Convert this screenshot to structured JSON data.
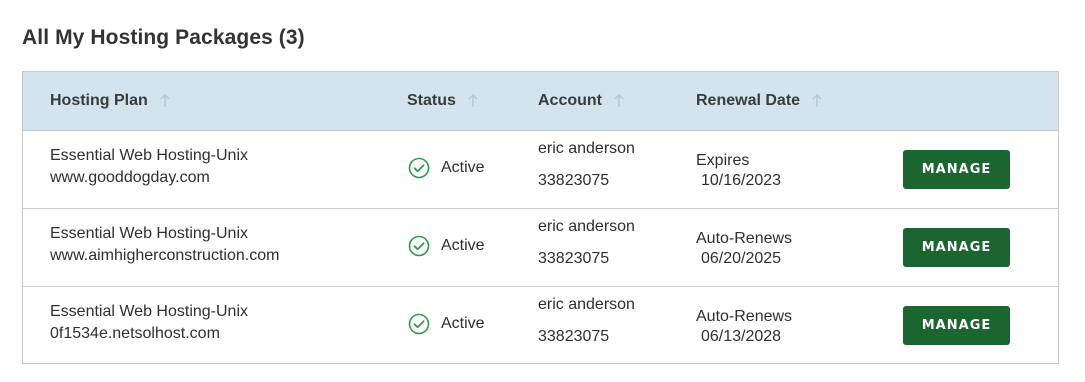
{
  "page": {
    "title": "All My Hosting Packages (3)"
  },
  "table": {
    "headers": [
      "Hosting Plan",
      "Status",
      "Account",
      "Renewal Date"
    ],
    "rows": [
      {
        "plan": "Essential Web Hosting-Unix",
        "domain": "www.gooddogday.com",
        "status": "Active",
        "account_name": "eric anderson",
        "account_number": "33823075",
        "renewal_type": "Expires",
        "renewal_date": "10/16/2023",
        "action": "MANAGE"
      },
      {
        "plan": "Essential Web Hosting-Unix",
        "domain": "www.aimhigherconstruction.com",
        "status": "Active",
        "account_name": "eric anderson",
        "account_number": "33823075",
        "renewal_type": "Auto-Renews",
        "renewal_date": "06/20/2025",
        "action": "MANAGE"
      },
      {
        "plan": "Essential Web Hosting-Unix",
        "domain": "0f1534e.netsolhost.com",
        "status": "Active",
        "account_name": "eric anderson",
        "account_number": "33823075",
        "renewal_type": "Auto-Renews",
        "renewal_date": "06/13/2028",
        "action": "MANAGE"
      }
    ]
  },
  "icons": {
    "sort": "arrow-up-icon",
    "status": "check-circle-icon"
  },
  "colors": {
    "header_bg": "#d3e4ee",
    "button_bg": "#1a6530",
    "status_check": "#2e9b4b"
  }
}
